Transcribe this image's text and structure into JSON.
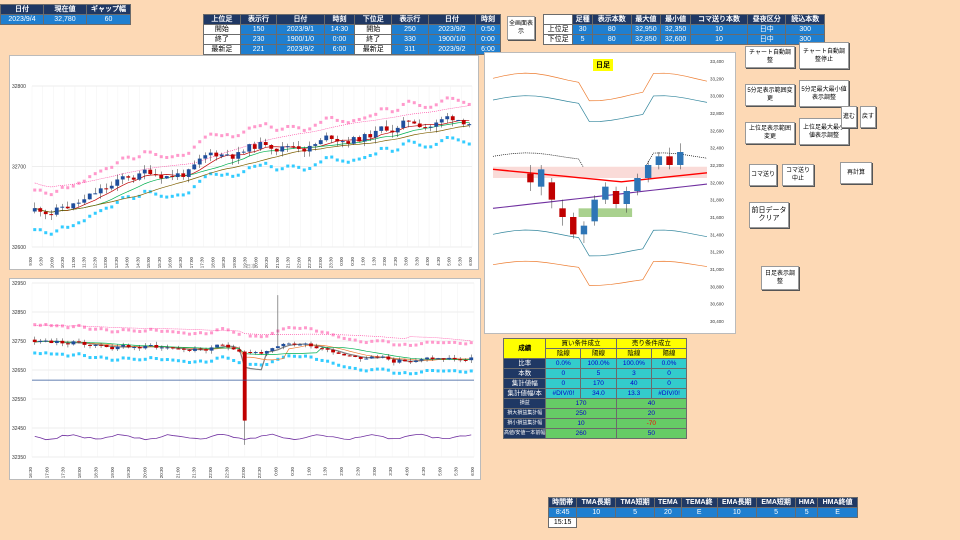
{
  "top_left": {
    "headers": [
      "日付",
      "現在値",
      "ギャップ幅"
    ],
    "values": [
      "2023/9/4",
      "32,780",
      "60"
    ]
  },
  "range_table": {
    "headers": [
      "上位足",
      "表示行",
      "日付",
      "時刻",
      "下位足",
      "表示行",
      "日付",
      "時刻"
    ],
    "rows": [
      [
        "開始",
        "150",
        "2023/9/1",
        "14:30",
        "開始",
        "250",
        "2023/9/2",
        "0:50"
      ],
      [
        "終了",
        "230",
        "1900/1/0",
        "0:00",
        "終了",
        "330",
        "1900/1/0",
        "0:00"
      ],
      [
        "最新足",
        "221",
        "2023/9/2",
        "6:00",
        "最新足",
        "311",
        "2023/9/2",
        "6:00"
      ]
    ]
  },
  "full_display_button": "全画面表示",
  "settings_table": {
    "headers": [
      "",
      "足種",
      "表示本数",
      "最大値",
      "最小値",
      "コマ送り本数",
      "昼夜区分",
      "読込本数"
    ],
    "rows": [
      [
        "上位足",
        "30",
        "80",
        "32,950",
        "32,350",
        "10",
        "日中",
        "300"
      ],
      [
        "下位足",
        "5",
        "80",
        "32,850",
        "32,600",
        "10",
        "日中",
        "300"
      ]
    ]
  },
  "buttons": {
    "chart_auto_adjust": "チャート自動調整",
    "chart_auto_adjust_stop": "チャート自動調整停止",
    "five_min_fit": "5分足表示範囲変更",
    "five_min_resize": "5分足最大最小値表示調整",
    "upper_fit": "上位足表示範囲変更",
    "upper_resize": "上位足最大最小値表示調整",
    "advance": "進む",
    "back": "戻す",
    "step": "コマ送り",
    "step_stop": "コマ送り中止",
    "redraw": "再計算",
    "prev_day": "前日データクリア",
    "daily_range": "日足表示調整"
  },
  "daily_chart": {
    "title": "日足",
    "y_ticks": [
      "33,400",
      "33,200",
      "33,000",
      "32,800",
      "32,600",
      "32,400",
      "32,200",
      "32,000",
      "31,800",
      "31,600",
      "31,400",
      "31,200",
      "31,000",
      "30,800",
      "30,600",
      "30,400"
    ]
  },
  "upper_chart": {
    "y_ticks": [
      "32800",
      "32700",
      "32600"
    ],
    "x_ticks": [
      "9:00",
      "9:30",
      "10:00",
      "10:30",
      "11:00",
      "11:30",
      "12:30",
      "13:00",
      "13:30",
      "14:00",
      "14:30",
      "15:00",
      "15:30",
      "16:00",
      "16:30",
      "17:00",
      "17:30",
      "18:00",
      "18:30",
      "19:00",
      "19:30",
      "20:00",
      "20:30",
      "21:00",
      "21:30",
      "22:00",
      "22:30",
      "23:00",
      "23:30",
      "0:00",
      "0:30",
      "1:00",
      "1:30",
      "2:00",
      "2:30",
      "3:00",
      "3:30",
      "4:00",
      "4:30",
      "5:00",
      "5:30",
      "6:00"
    ],
    "watermark": "日本"
  },
  "lower_chart": {
    "y_ticks": [
      "32950",
      "32850",
      "32750",
      "32650",
      "32550",
      "32450",
      "32350"
    ],
    "x_ticks": [
      "16:30",
      "17:00",
      "17:30",
      "18:00",
      "18:30",
      "19:00",
      "19:30",
      "20:00",
      "20:30",
      "21:00",
      "21:30",
      "22:00",
      "22:30",
      "23:00",
      "23:30",
      "0:00",
      "0:30",
      "1:00",
      "1:30",
      "2:00",
      "2:30",
      "3:00",
      "3:30",
      "4:00",
      "4:30",
      "5:00",
      "5:30",
      "6:00"
    ]
  },
  "performance": {
    "title": "成績",
    "buy_title": "買い条件成立",
    "sell_title": "売り条件成立",
    "sub": [
      "陰線",
      "陽線",
      "陰線",
      "陽線"
    ],
    "rows": [
      {
        "label": "比率",
        "cells": [
          "0.0%",
          "100.0%",
          "100.0%",
          "0.0%"
        ]
      },
      {
        "label": "本数",
        "cells": [
          "0",
          "5",
          "3",
          "0"
        ]
      },
      {
        "label": "集計値幅",
        "cells": [
          "0",
          "170",
          "40",
          "0"
        ]
      },
      {
        "label": "集計値幅/本",
        "cells": [
          "#DIV/0!",
          "34.0",
          "13.3",
          "#DIV/0!"
        ]
      }
    ],
    "merged_rows": [
      {
        "label": "損益",
        "buy": "170",
        "sell": "40"
      },
      {
        "label": "損大損益集計幅",
        "buy": "250",
        "sell": "20"
      },
      {
        "label": "損小損益集計幅",
        "buy": "10",
        "sell": "-70"
      },
      {
        "label": "高値/安値一本前幅",
        "buy": "260",
        "sell": "50"
      }
    ]
  },
  "bottom_table": {
    "headers": [
      "時間帯",
      "TMA長期",
      "TMA短期",
      "TEMA",
      "TEMA終",
      "EMA長期",
      "EMA短期",
      "HMA",
      "HMA終値"
    ],
    "values": [
      "8:45",
      "10",
      "5",
      "20",
      "E",
      "10",
      "5",
      "5",
      "E"
    ],
    "extra": "15:15"
  }
}
